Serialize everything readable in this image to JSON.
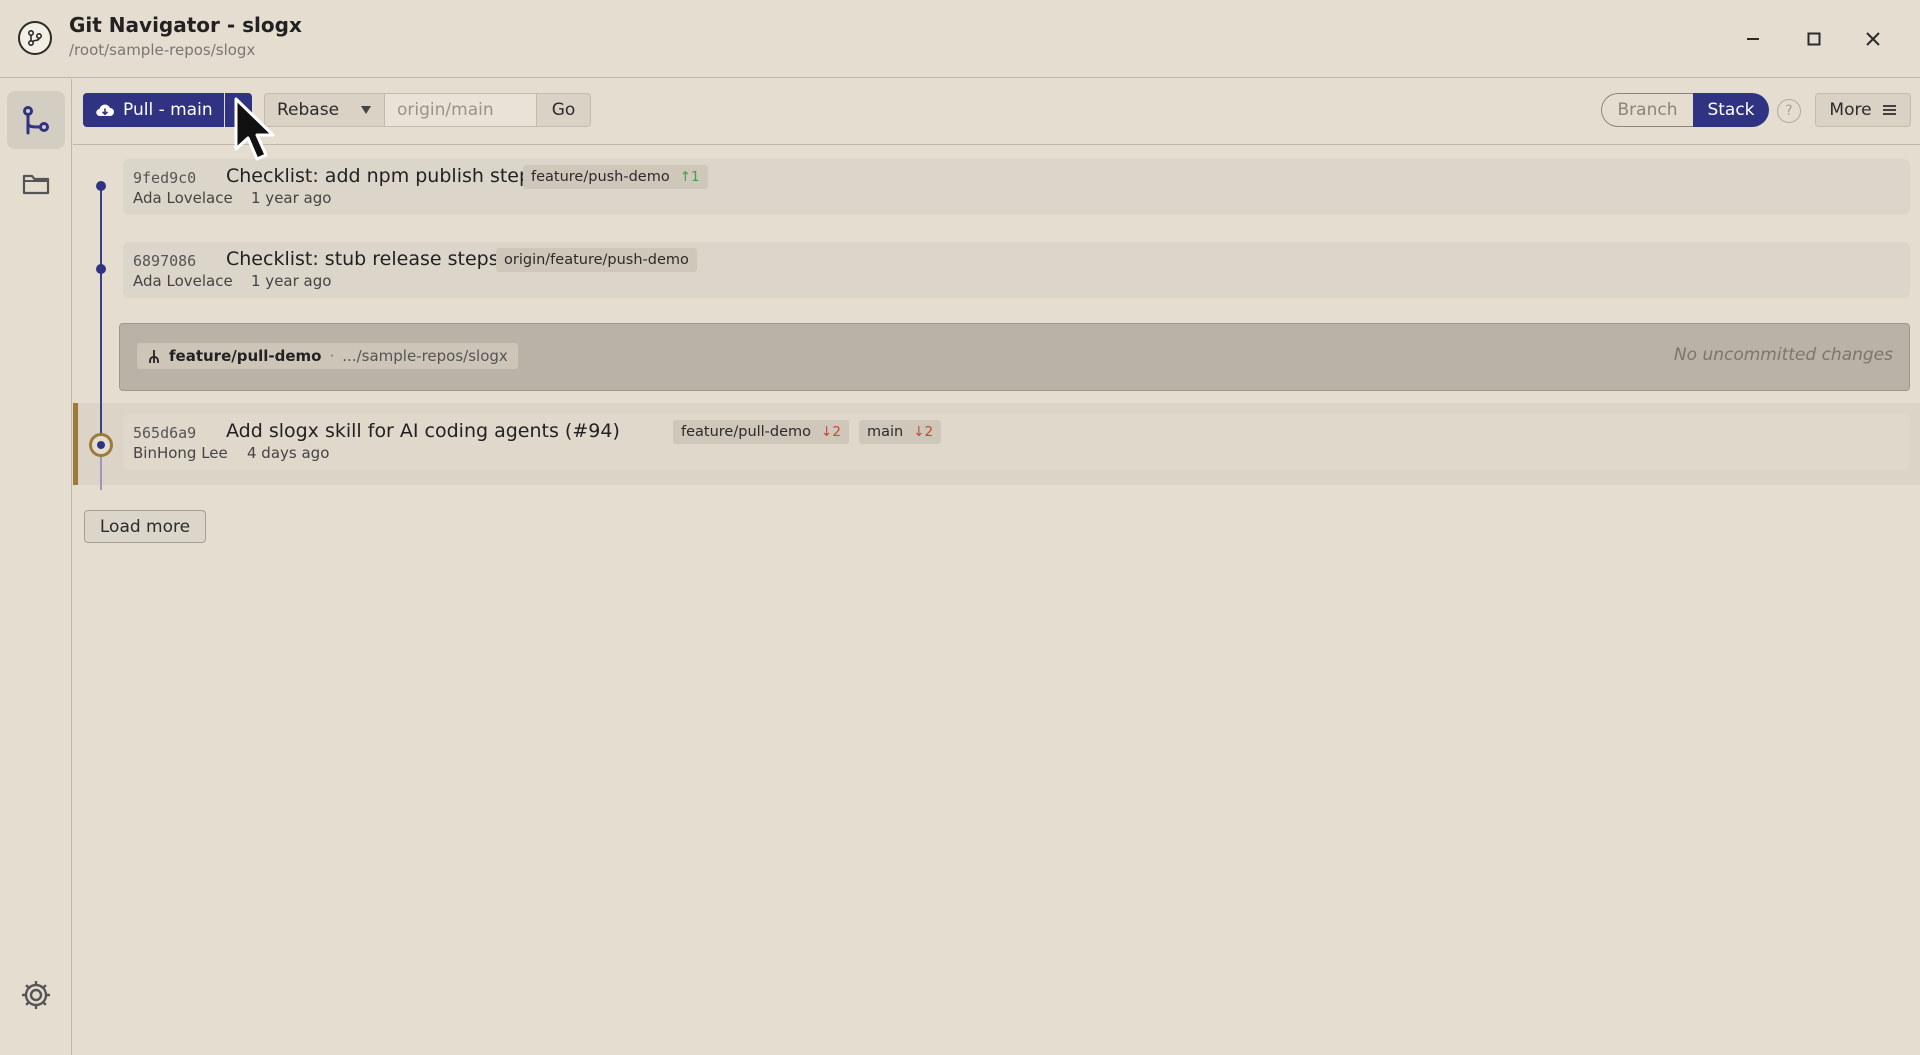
{
  "window": {
    "title": "Git Navigator - slogx",
    "path": "/root/sample-repos/slogx"
  },
  "rail": {
    "items": [
      {
        "icon": "git-graph-icon",
        "active": true
      },
      {
        "icon": "folder-icon",
        "active": false
      }
    ],
    "settings_icon": "gear-icon"
  },
  "toolbar": {
    "pull_label": "Pull - main",
    "mode_value": "Rebase",
    "target_placeholder": "origin/main",
    "go_label": "Go",
    "view_branch_label": "Branch",
    "view_stack_label": "Stack",
    "view_selected": "Stack",
    "help_label": "?",
    "more_label": "More"
  },
  "commits": [
    {
      "hash": "9fed9c0",
      "subject": "Checklist: add npm publish step",
      "author": "Ada Lovelace",
      "date": "1 year ago",
      "refs": [
        {
          "name": "feature/push-demo",
          "ahead": "↑1"
        }
      ]
    },
    {
      "hash": "6897086",
      "subject": "Checklist: stub release steps",
      "author": "Ada Lovelace",
      "date": "1 year ago",
      "refs": [
        {
          "name": "origin/feature/push-demo"
        }
      ]
    }
  ],
  "worktree": {
    "branch": "feature/pull-demo",
    "separator": "·",
    "path": ".../sample-repos/slogx",
    "status": "No uncommitted changes"
  },
  "head_commit": {
    "hash": "565d6a9",
    "subject": "Add slogx skill for AI coding agents (#94)",
    "author": "BinHong Lee",
    "date": "4 days ago",
    "refs": [
      {
        "name": "feature/pull-demo",
        "behind": "↓2"
      },
      {
        "name": "main",
        "behind": "↓2"
      }
    ]
  },
  "load_more_label": "Load more",
  "colors": {
    "accent": "#2f3382",
    "background": "#e5ddd0",
    "head_marker": "#9b7a3a",
    "ahead": "#4b9a4b",
    "behind": "#d0433a"
  }
}
